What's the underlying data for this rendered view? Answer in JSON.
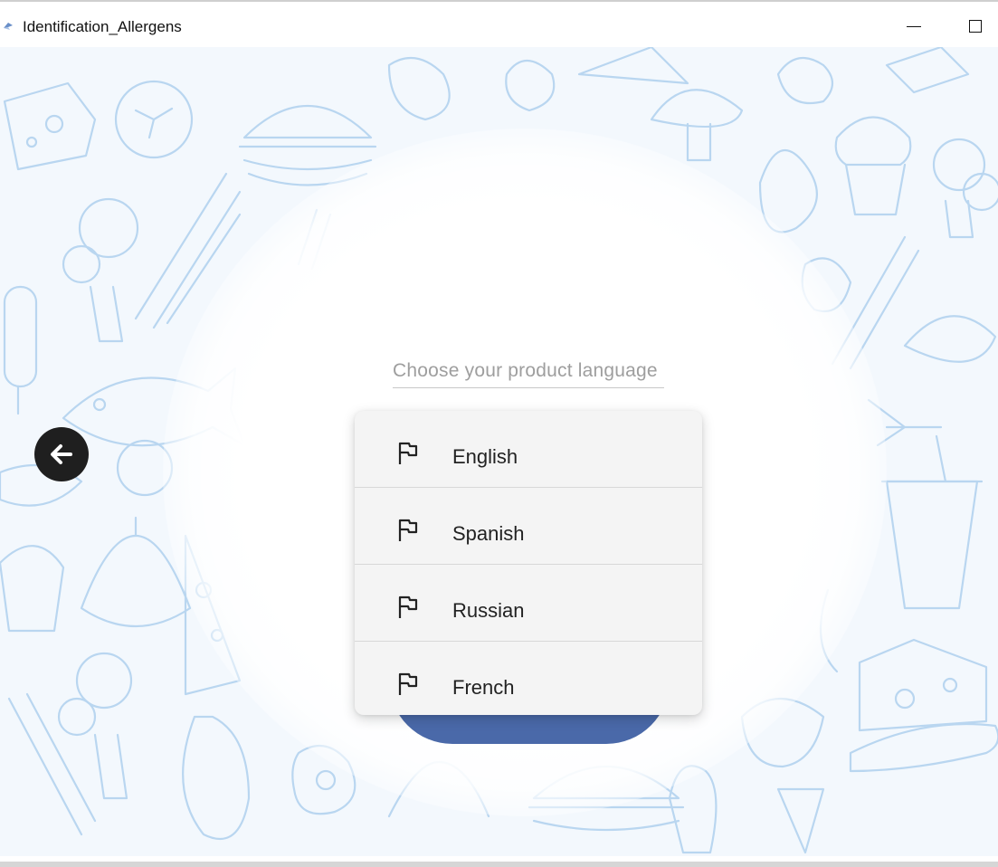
{
  "window": {
    "title": "Identification_Allergens",
    "icon": "app-icon",
    "controls": [
      "minimize-icon",
      "maximize-icon"
    ]
  },
  "colors": {
    "background": "#f3f8fd",
    "doodle_stroke": "#b9d6f0",
    "back_button": "#1f1f1f",
    "primary_button": "#4a69a9",
    "dropdown_bg": "#f4f4f4"
  },
  "main": {
    "back_icon": "arrow-left-icon",
    "language_select": {
      "placeholder": "Choose your product language"
    },
    "dropdown": {
      "items": [
        {
          "label": "English",
          "icon": "flag-icon"
        },
        {
          "label": "Spanish",
          "icon": "flag-icon"
        },
        {
          "label": "Russian",
          "icon": "flag-icon"
        },
        {
          "label": "French",
          "icon": "flag-icon"
        }
      ]
    }
  }
}
